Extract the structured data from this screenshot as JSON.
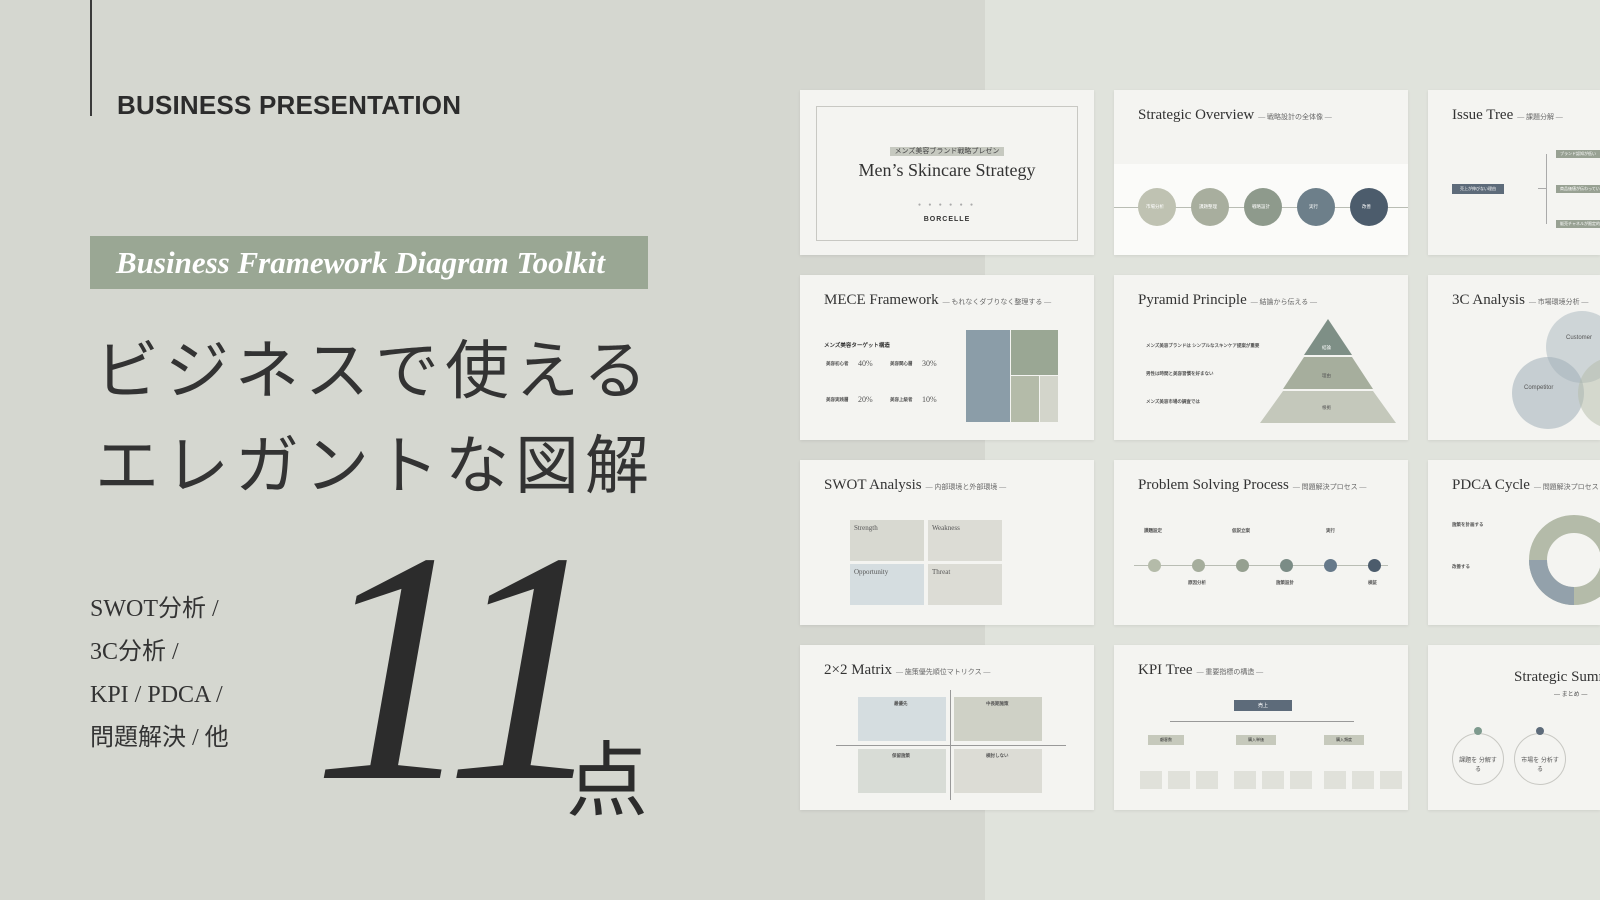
{
  "header": {
    "brand": "BUSINESS PRESENTATION"
  },
  "subtitle": "Business Framework Diagram Toolkit",
  "headline": {
    "line1": "ビジネスで使える",
    "line2": "エレガントな図解"
  },
  "topics": [
    "SWOT分析 /",
    "3C分析 /",
    "KPI / PDCA /",
    "問題解決 / 他"
  ],
  "count": {
    "number": "11",
    "unit": "点"
  },
  "slides": {
    "cover": {
      "tag": "メンズ美容ブランド戦略プレゼン",
      "title": "Men’s Skincare Strategy",
      "brand": "BORCELLE"
    },
    "overview": {
      "title": "Strategic Overview",
      "sub": "— 戦略設計の全体像 —",
      "steps": [
        "市場分析",
        "課題整理",
        "戦略設計",
        "実行",
        "改善"
      ]
    },
    "issue_tree": {
      "title": "Issue Tree",
      "sub": "— 課題分解 —",
      "root": "売上が伸びない理由",
      "branches": [
        "ブランド認知が低い",
        "商品価値が伝わっていない",
        "販売チャネルが限定的"
      ]
    },
    "mece": {
      "title": "MECE Framework",
      "sub": "— もれなくダブりなく整理する —",
      "heading": "メンズ美容ターゲット構造",
      "cells": [
        {
          "label": "美容初心者",
          "pct": "40%"
        },
        {
          "label": "美容関心層",
          "pct": "30%"
        },
        {
          "label": "美容実践層",
          "pct": "20%"
        },
        {
          "label": "美容上級者",
          "pct": "10%"
        }
      ]
    },
    "pyramid": {
      "title": "Pyramid Principle",
      "sub": "— 結論から伝える —",
      "lines": [
        "メンズ美容ブランドは シンプルなスキンケア提案が重要",
        "男性は時間と美容習慣を好まない",
        "メンズ美容市場の調査では"
      ],
      "levels": [
        "結論",
        "理由",
        "根拠"
      ]
    },
    "c3": {
      "title": "3C Analysis",
      "sub": "— 市場環境分析 —",
      "labels": [
        "Customer",
        "Competitor"
      ]
    },
    "swot": {
      "title": "SWOT Analysis",
      "sub": "— 内部環境と外部環境 —",
      "quadrants": [
        "Strength",
        "Weakness",
        "Opportunity",
        "Threat"
      ]
    },
    "problem": {
      "title": "Problem Solving Process",
      "sub": "— 問題解決プロセス —",
      "steps": [
        "課題設定",
        "原因分析",
        "仮説立案",
        "施策設計",
        "実行",
        "検証"
      ]
    },
    "pdca": {
      "title": "PDCA Cycle",
      "sub": "— 問題解決プロセス —",
      "items": [
        "施策を計画する",
        "改善する"
      ]
    },
    "matrix": {
      "title": "2×2 Matrix",
      "sub": "— 施策優先順位マトリクス —",
      "cells": [
        "最優先",
        "中長期施策",
        "保留施策",
        "検討しない"
      ]
    },
    "kpi": {
      "title": "KPI Tree",
      "sub": "— 重要指標の構造 —",
      "root": "売上",
      "mid": [
        "顧客数",
        "購入単価",
        "購入頻度"
      ]
    },
    "summary": {
      "title": "Strategic Summary",
      "sub": "— まとめ —",
      "items": [
        "課題を 分解する",
        "市場を 分析する"
      ]
    }
  },
  "colors": {
    "sage": "#9aa794",
    "slate": "#5d6b7a",
    "dark": "#2e2e2e"
  }
}
